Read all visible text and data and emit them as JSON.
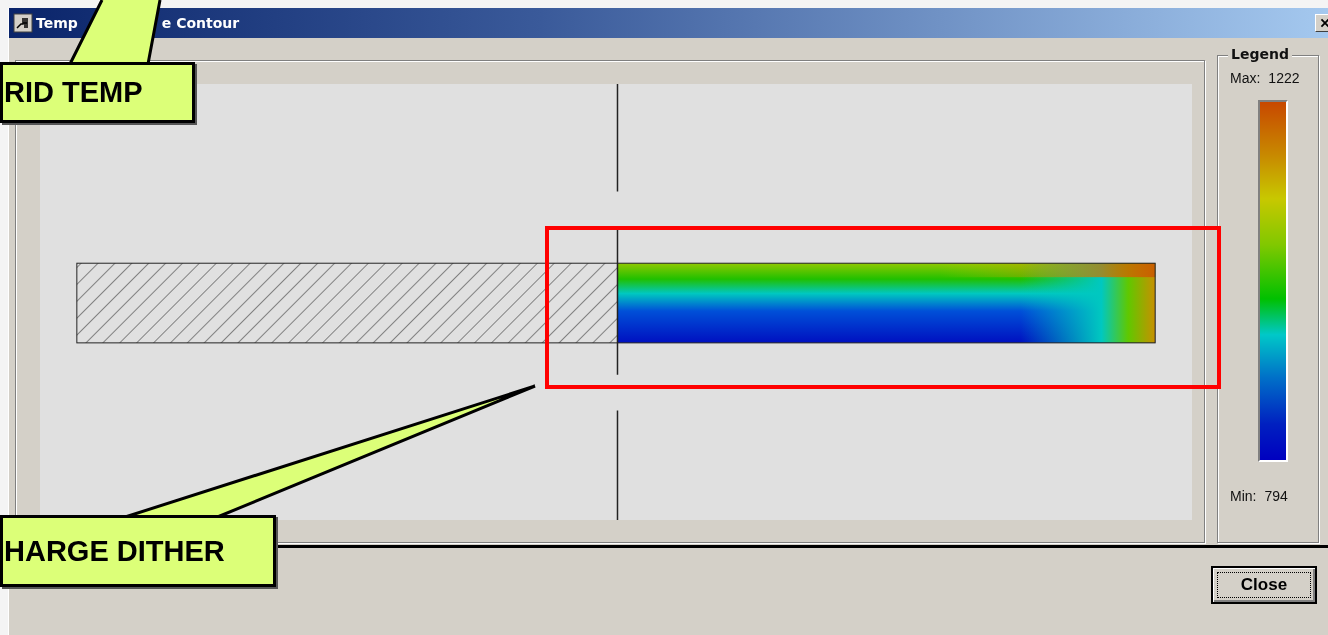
{
  "window": {
    "title_parts": [
      "Temp",
      "e Contour"
    ]
  },
  "legend": {
    "title": "Legend",
    "max_label": "Max:",
    "max_value": "1222",
    "min_label": "Min:",
    "min_value": "794"
  },
  "buttons": [
    "Close"
  ],
  "callouts": [
    {
      "text": "RID TEMP",
      "kind": "up"
    },
    {
      "text": "HARGE DITHER",
      "kind": "down-right"
    }
  ]
}
